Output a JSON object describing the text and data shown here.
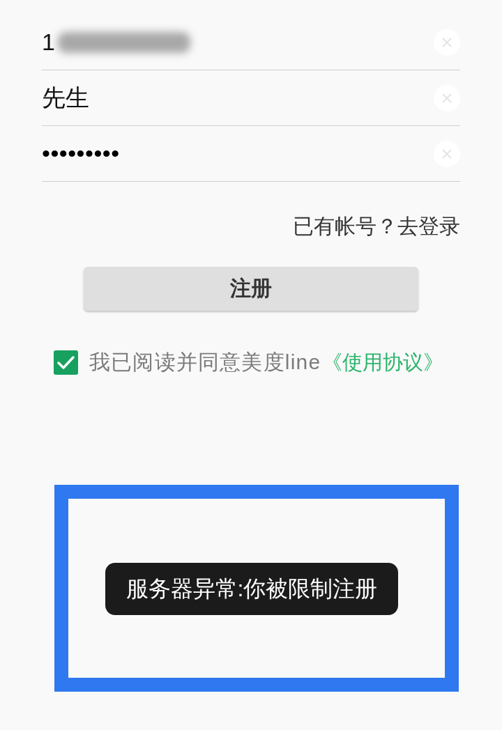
{
  "fields": [
    {
      "kind": "text",
      "value": "1",
      "redacted": true
    },
    {
      "kind": "text",
      "value": "先生",
      "redacted": false
    },
    {
      "kind": "password",
      "value": "•••••••••",
      "redacted": false
    }
  ],
  "login_link": "已有帐号？去登录",
  "register_button": "注册",
  "agreement": {
    "checked": true,
    "text": "我已阅读并同意美度line",
    "link": "《使用协议》"
  },
  "toast": "服务器异常:你被限制注册"
}
